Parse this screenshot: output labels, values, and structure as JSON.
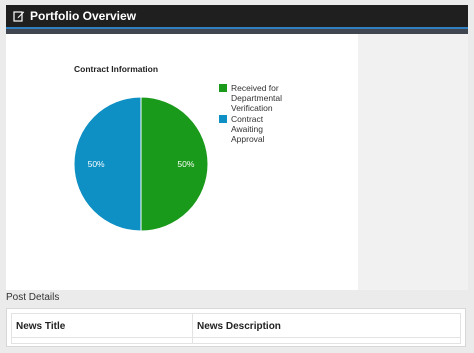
{
  "header": {
    "title": "Portfolio Overview",
    "icon": "edit-icon"
  },
  "chart": {
    "title": "Contract Information"
  },
  "chart_data": {
    "type": "pie",
    "title": "Contract Information",
    "series": [
      {
        "name": "Received for Departmental Verification",
        "value": 50,
        "label": "50%",
        "color": "#1a9a1a"
      },
      {
        "name": "Contract Awaiting Approval",
        "value": 50,
        "label": "50%",
        "color": "#0e90c4"
      }
    ],
    "legend_position": "right"
  },
  "post_details": {
    "label": "Post Details"
  },
  "news_table": {
    "columns": [
      "News Title",
      "News Description"
    ]
  },
  "colors": {
    "header_bg": "#1f1f1f",
    "accent": "#2f7fc1"
  }
}
